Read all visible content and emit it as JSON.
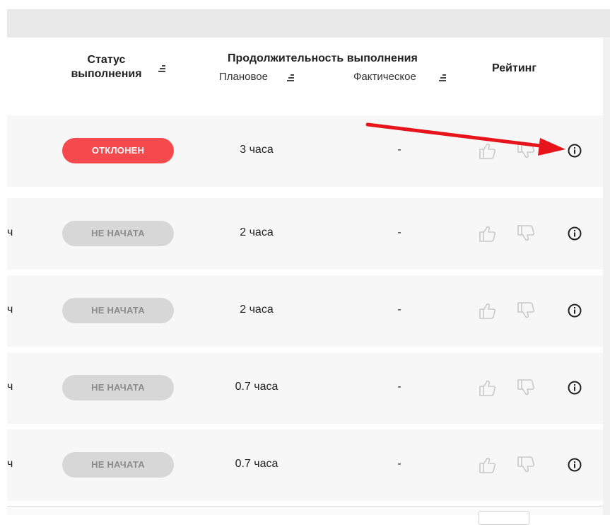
{
  "header": {
    "status_title_line1": "Статус",
    "status_title_line2": "выполнения",
    "duration_title": "Продолжительность выполнения",
    "planned_label": "Плановое",
    "actual_label": "Фактическое",
    "rating_title": "Рейтинг"
  },
  "rows": [
    {
      "cut_text": "",
      "status": "ОТКЛОНЕН",
      "status_type": "rejected",
      "planned": "3 часа",
      "actual": "-"
    },
    {
      "cut_text": "ч",
      "status": "НЕ НАЧАТА",
      "status_type": "notstarted",
      "planned": "2 часа",
      "actual": "-"
    },
    {
      "cut_text": "ч",
      "status": "НЕ НАЧАТА",
      "status_type": "notstarted",
      "planned": "2 часа",
      "actual": "-"
    },
    {
      "cut_text": "ч",
      "status": "НЕ НАЧАТА",
      "status_type": "notstarted",
      "planned": "0.7 часа",
      "actual": "-"
    },
    {
      "cut_text": "ч",
      "status": "НЕ НАЧАТА",
      "status_type": "notstarted",
      "planned": "0.7 часа",
      "actual": "-"
    }
  ],
  "icons": {
    "sort": "sort-icon",
    "like": "thumbs-up-icon",
    "dislike": "thumbs-down-icon",
    "info": "info-icon",
    "annotation": "red-arrow-icon"
  },
  "colors": {
    "rejected": "#f6494e",
    "not_started_bg": "#d7d7d7",
    "not_started_text": "#8c8c8c",
    "annotation_arrow": "#e8141b"
  }
}
